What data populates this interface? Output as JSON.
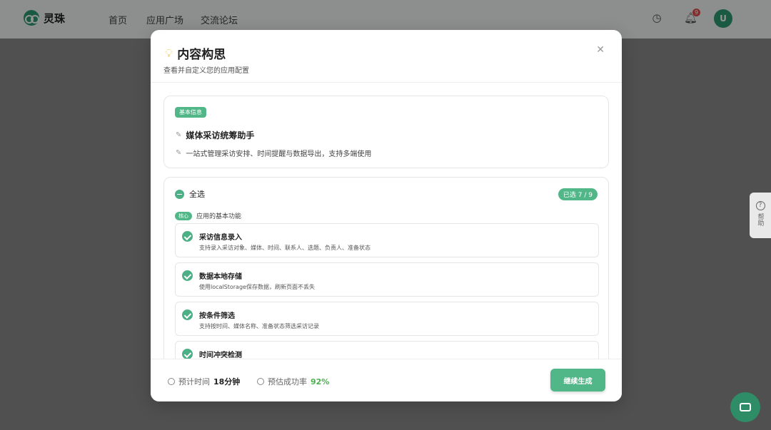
{
  "nav": {
    "brand": "灵珠",
    "links": [
      "首页",
      "应用广场",
      "交流论坛"
    ],
    "notif_count": "9",
    "avatar_initial": "U"
  },
  "help_tab": {
    "label": "帮助"
  },
  "modal": {
    "title": "内容构思",
    "subtitle": "查看并自定义您的应用配置",
    "basic_info": {
      "tag": "基本信息",
      "app_name": "媒体采访统筹助手",
      "app_desc": "一站式管理采访安排、时间提醒与数据导出，支持多端使用"
    },
    "features": {
      "select_all_label": "全选",
      "selected_count": "已选 7 / 9",
      "group_tag": "核心",
      "group_label": "应用的基本功能",
      "items": [
        {
          "title": "采访信息录入",
          "desc": "支持录入采访对象、媒体、时间、联系人、选题、负责人、准备状态"
        },
        {
          "title": "数据本地存储",
          "desc": "使用localStorage保存数据，刷新页面不丢失"
        },
        {
          "title": "按条件筛选",
          "desc": "支持按时间、媒体名称、准备状态筛选采访记录"
        },
        {
          "title": "时间冲突检测",
          "desc": ""
        }
      ]
    },
    "footer": {
      "time_label": "预计时间",
      "time_value": "18分钟",
      "success_label": "预估成功率",
      "success_value": "92%",
      "continue_label": "继续生成"
    }
  },
  "colors": {
    "accent": "#52b788",
    "success_text": "#4caf50"
  }
}
